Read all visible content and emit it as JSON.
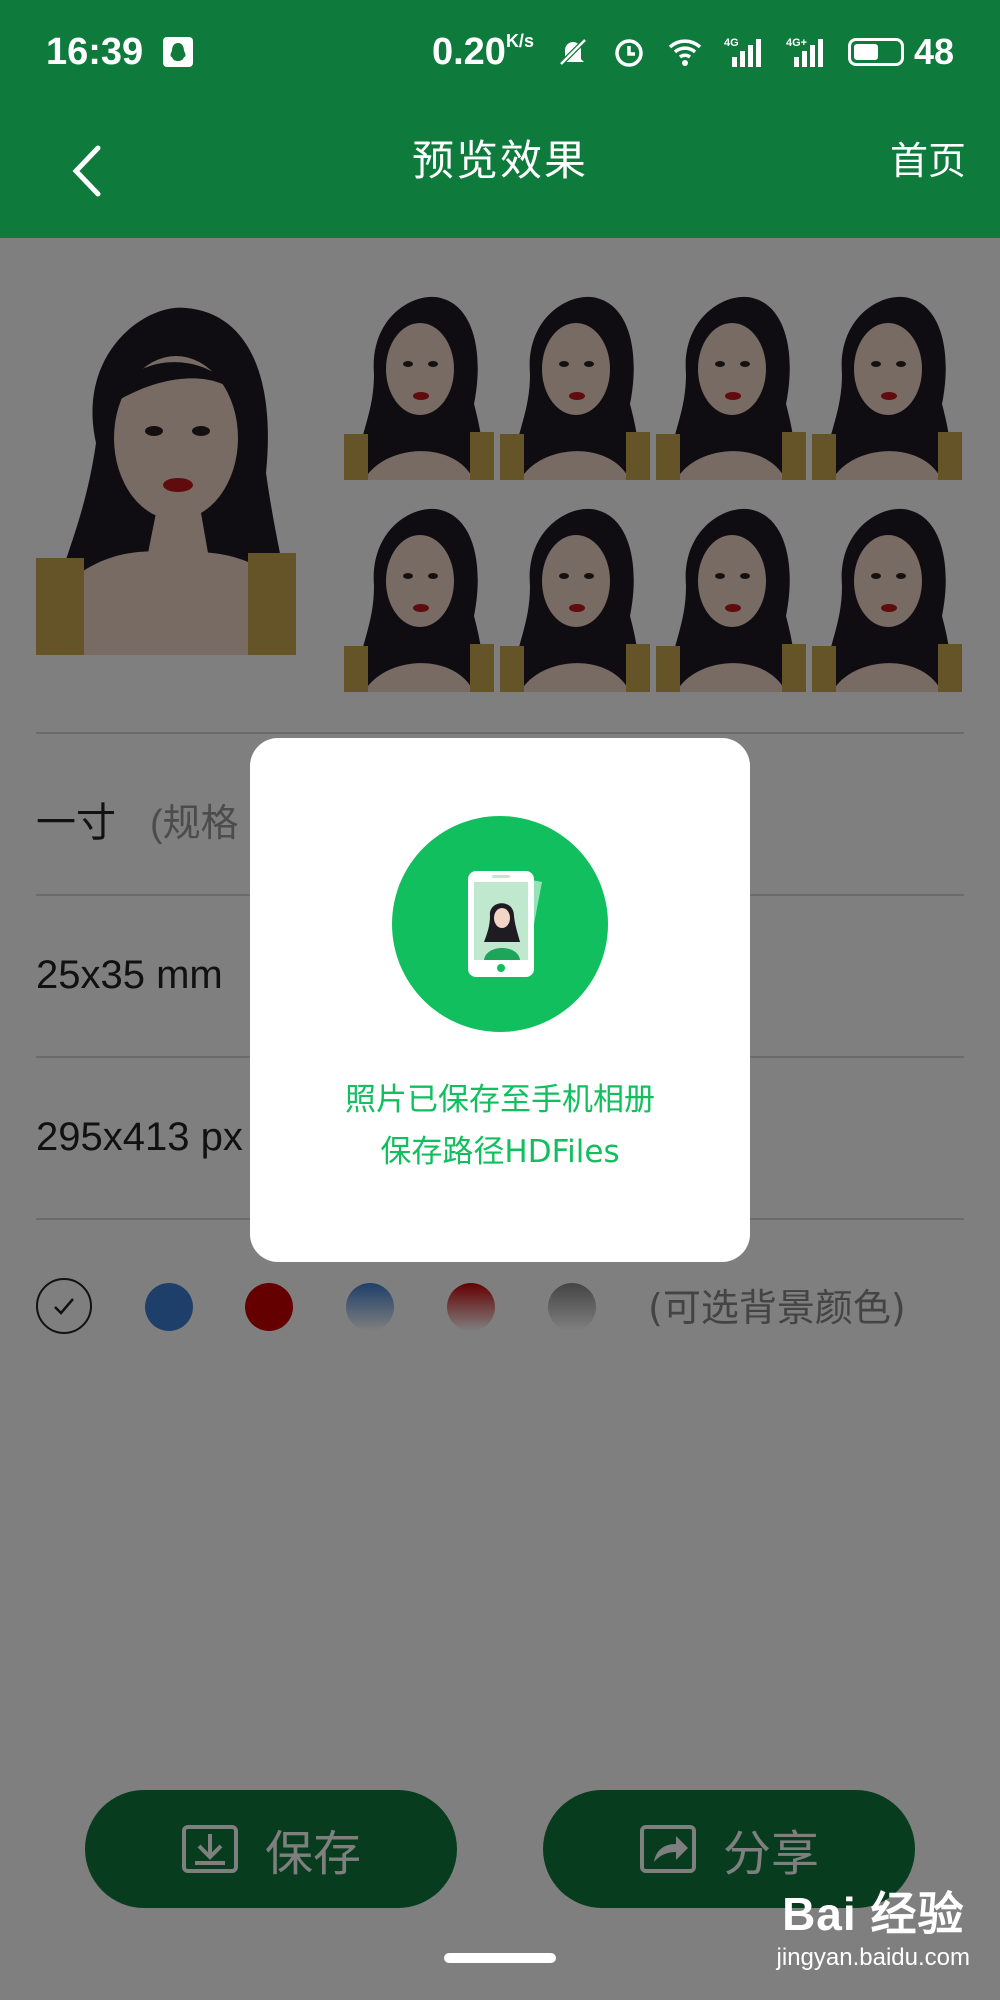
{
  "status_bar": {
    "time": "16:39",
    "net_speed": "0.20",
    "net_unit": "K/s",
    "battery": "48",
    "icons": [
      "qq-icon",
      "mute-icon",
      "alarm-icon",
      "wifi-icon",
      "signal-4g-icon",
      "signal-4g-plus-icon",
      "battery-icon"
    ]
  },
  "app_bar": {
    "title": "预览效果",
    "home": "首页"
  },
  "specs": {
    "name": "一寸",
    "name_note": "(规格",
    "mm": "25x35 mm",
    "px": "295x413 px"
  },
  "background_colors": {
    "label": "(可选背景颜色)",
    "colors": [
      "#ffffff",
      "#3d7fd2",
      "#c90000",
      "#4b86d3",
      "#c90000",
      "#9a9a9a"
    ]
  },
  "actions": {
    "save": "保存",
    "share": "分享"
  },
  "dialog": {
    "line1": "照片已保存至手机相册",
    "line2": "保存路径HDFiles"
  },
  "watermark": {
    "logo": "Bai 经验",
    "url": "jingyan.baidu.com"
  },
  "colors": {
    "brand_green": "#0e7a3c",
    "dialog_green": "#12bf5f"
  }
}
